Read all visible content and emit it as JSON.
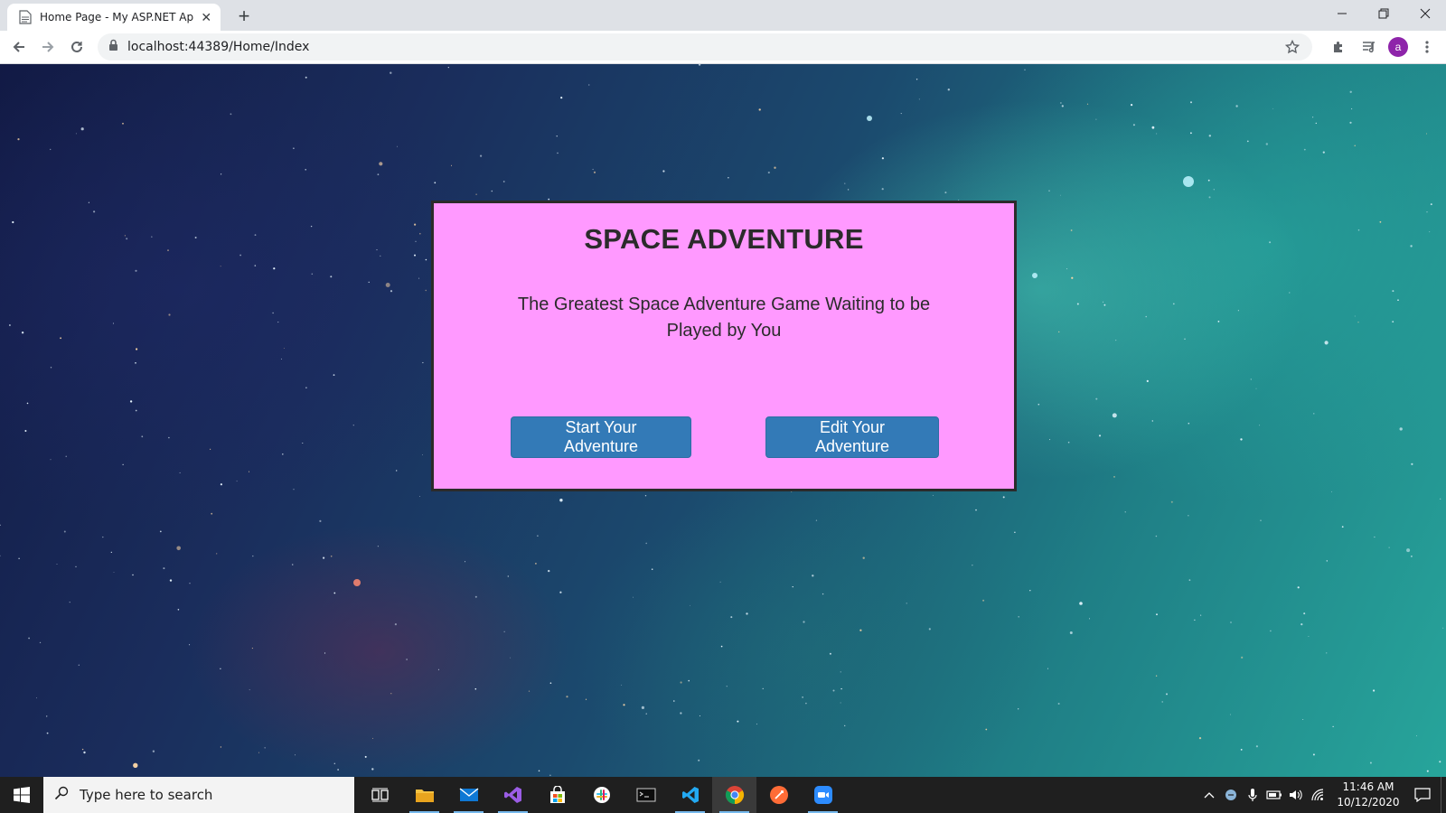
{
  "browser": {
    "tab": {
      "title": "Home Page - My ASP.NET Applic",
      "favicon": "document-icon",
      "close_label": "✕"
    },
    "new_tab_label": "+",
    "window_controls": {
      "minimize": "—",
      "restore": "❐",
      "close": "✕"
    },
    "url": "localhost:44389/Home/Index",
    "profile_initial": "a"
  },
  "page": {
    "title": "SPACE ADVENTURE",
    "subtitle": "The Greatest Space Adventure Game Waiting to be Played by You",
    "buttons": {
      "start": "Start Your Adventure",
      "edit": "Edit Your Adventure"
    },
    "colors": {
      "card_background": "#ff99ff",
      "card_border": "#2b2b2b",
      "button_background": "#337ab7"
    }
  },
  "taskbar": {
    "search_placeholder": "Type here to search",
    "apps": [
      "task-view",
      "file-explorer",
      "mail",
      "visual-studio",
      "microsoft-store",
      "slack",
      "terminal",
      "vs-code",
      "chrome",
      "postman",
      "zoom"
    ],
    "clock": {
      "time": "11:46 AM",
      "date": "10/12/2020"
    }
  }
}
